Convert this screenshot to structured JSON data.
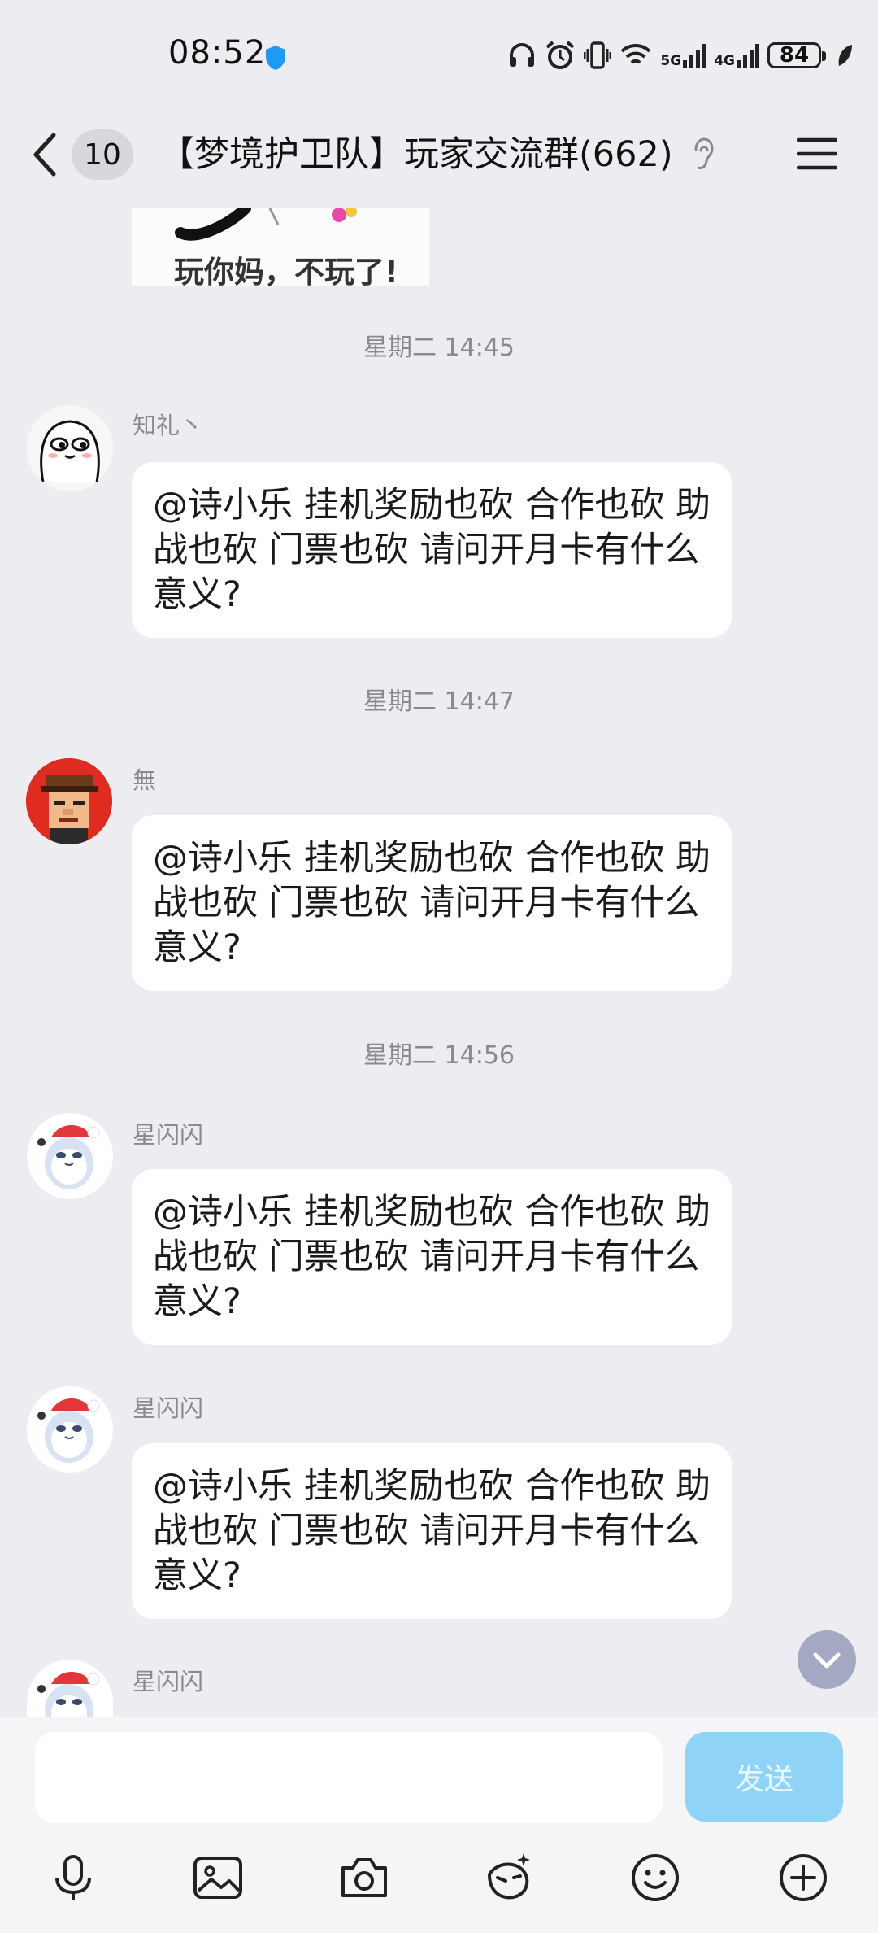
{
  "status_bar": {
    "time": "08:52",
    "network_1": "5G",
    "network_2": "4G",
    "battery": "84",
    "icons": [
      "headphones-icon",
      "alarm-icon",
      "vibrate-icon",
      "wifi-icon",
      "signal-5g-icon",
      "signal-4g-icon",
      "battery-icon",
      "leaf-icon"
    ]
  },
  "header": {
    "back_count": "10",
    "title": "【梦境护卫队】玩家交流群(662)"
  },
  "sticker": {
    "caption": "玩你妈，不玩了!"
  },
  "messages": [
    {
      "timestamp": "星期二 14:45",
      "sender": "知礼丶",
      "text": "@诗小乐 挂机奖励也砍 合作也砍 助战也砍 门票也砍 请问开月卡有什么意义?"
    },
    {
      "timestamp": "星期二 14:47",
      "sender": "無",
      "text": "@诗小乐 挂机奖励也砍 合作也砍 助战也砍 门票也砍 请问开月卡有什么意义?"
    },
    {
      "timestamp": "星期二 14:56",
      "sender": "星闪闪",
      "text": "@诗小乐 挂机奖励也砍 合作也砍 助战也砍 门票也砍 请问开月卡有什么意义?"
    },
    {
      "sender": "星闪闪",
      "text": "@诗小乐 挂机奖励也砍 合作也砍 助战也砍 门票也砍 请问开月卡有什么意义?"
    },
    {
      "sender": "星闪闪"
    }
  ],
  "input": {
    "placeholder": "",
    "send_label": "发送"
  },
  "toolbar": [
    "microphone-icon",
    "image-icon",
    "camera-icon",
    "magic-face-icon",
    "emoji-icon",
    "plus-icon"
  ],
  "colors": {
    "background": "#ececf1",
    "bubble": "#ffffff",
    "send_button": "#8fd3f6",
    "scroll_button": "#a4a8c2"
  }
}
